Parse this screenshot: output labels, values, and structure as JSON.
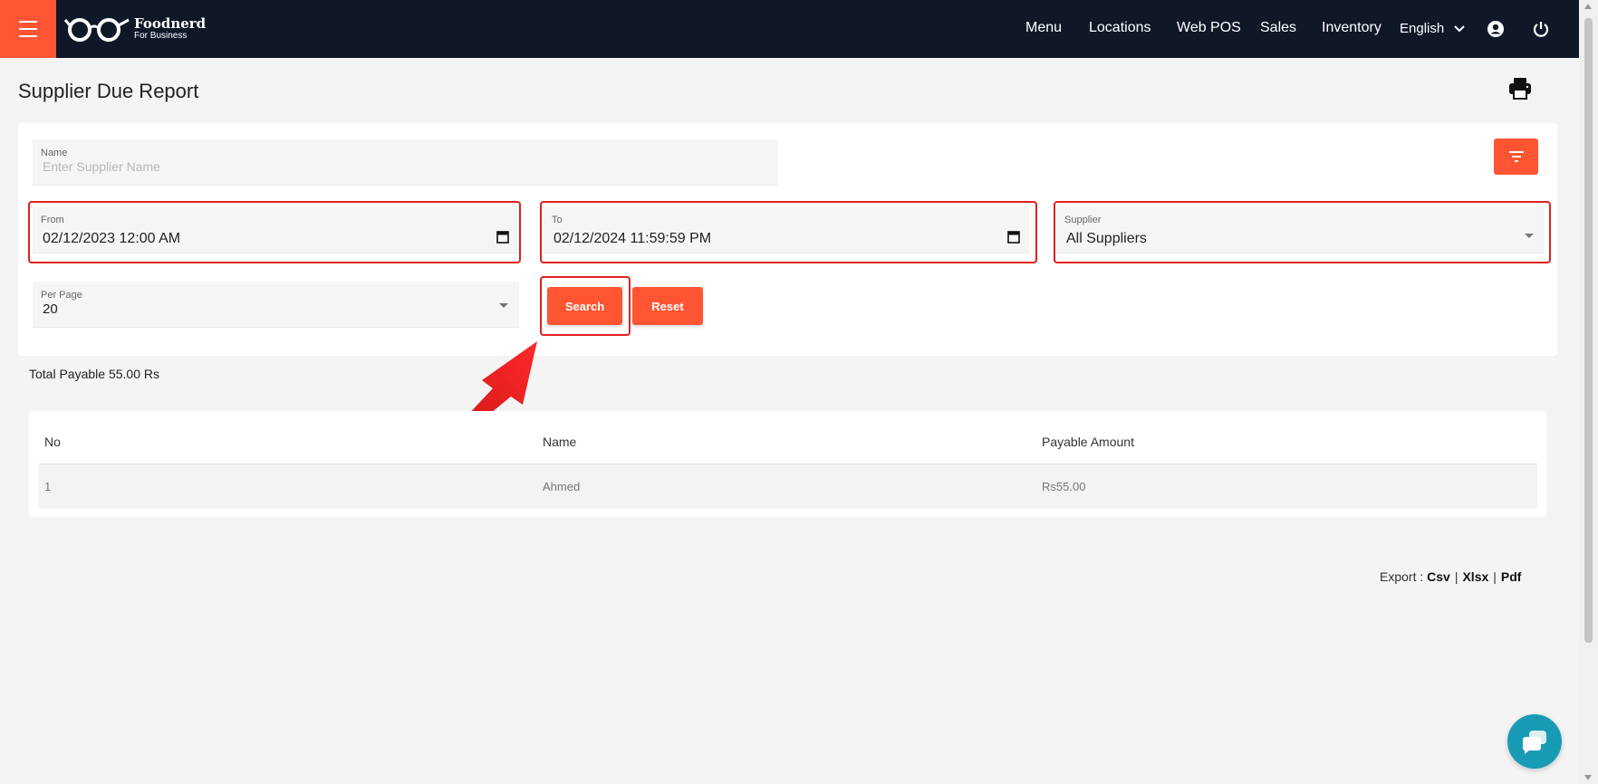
{
  "nav": {
    "logo_name": "Foodnerd",
    "logo_sub": "For Business",
    "items": [
      "Menu",
      "Locations",
      "Web POS",
      "Sales",
      "Inventory"
    ],
    "language": "English"
  },
  "page": {
    "title": "Supplier Due Report"
  },
  "filters": {
    "name_label": "Name",
    "name_placeholder": "Enter Supplier Name",
    "from_label": "From",
    "from_value": "02/12/2023 12:00 AM",
    "to_label": "To",
    "to_value": "02/12/2024 11:59:59 PM",
    "supplier_label": "Supplier",
    "supplier_value": "All Suppliers",
    "per_page_label": "Per Page",
    "per_page_value": "20",
    "search_label": "Search",
    "reset_label": "Reset"
  },
  "summary": {
    "total_payable": "Total Payable 55.00 Rs"
  },
  "table": {
    "columns": [
      "No",
      "Name",
      "Payable Amount"
    ],
    "rows": [
      [
        "1",
        "Ahmed",
        "Rs55.00"
      ]
    ]
  },
  "export": {
    "label": "Export :",
    "csv": "Csv",
    "xlsx": "Xlsx",
    "pdf": "Pdf",
    "separator": "|"
  },
  "colors": {
    "accent": "#ff5533",
    "topbar": "#101828",
    "highlight": "#e02020",
    "chat": "#1a9bb5"
  }
}
